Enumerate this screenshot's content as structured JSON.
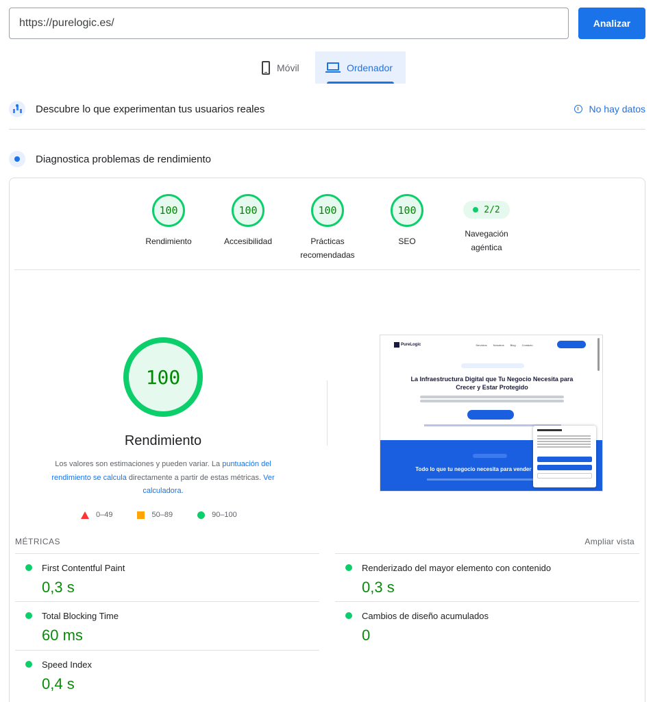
{
  "search": {
    "url": "https://purelogic.es/",
    "analyze_label": "Analizar"
  },
  "device_tabs": [
    {
      "label": "Móvil",
      "icon": "phone-icon",
      "selected": false
    },
    {
      "label": "Ordenador",
      "icon": "laptop-icon",
      "selected": true
    }
  ],
  "field_section": {
    "title": "Descubre lo que experimentan tus usuarios reales",
    "status": "No hay datos"
  },
  "lab_section": {
    "title": "Diagnostica problemas de rendimiento"
  },
  "categories": [
    {
      "score": "100",
      "label": "Rendimiento"
    },
    {
      "score": "100",
      "label": "Accesibilidad"
    },
    {
      "score": "100",
      "label": "Prácticas recomendadas"
    },
    {
      "score": "100",
      "label": "SEO"
    },
    {
      "score": "2/2",
      "label": "Navegación agéntica"
    }
  ],
  "performance": {
    "score": "100",
    "label": "Rendimiento",
    "desc_before": "Los valores son estimaciones y pueden variar. La ",
    "desc_link1": "puntuación del rendimiento se calcula",
    "desc_middle": " directamente a partir de estas métricas. ",
    "desc_link2": "Ver calculadora.",
    "legend": [
      "0–49",
      "50–89",
      "90–100"
    ]
  },
  "thumbnail": {
    "logo": "PureLogic",
    "nav_links": [
      "Servicios",
      "Nosotros",
      "Blog",
      "Contacto"
    ],
    "headline": "La Infraestructura Digital que Tu Negocio Necesita para Crecer y Estar Protegido",
    "blue_headline": "Todo lo que tu negocio necesita para vender más"
  },
  "metrics_section": {
    "title": "MÉTRICAS",
    "expand_label": "Ampliar vista"
  },
  "metrics": [
    {
      "label": "First Contentful Paint",
      "value": "0,3 s"
    },
    {
      "label": "Renderizado del mayor elemento con contenido",
      "value": "0,3 s"
    },
    {
      "label": "Total Blocking Time",
      "value": "60 ms"
    },
    {
      "label": "Cambios de diseño acumulados",
      "value": "0"
    },
    {
      "label": "Speed Index",
      "value": "0,4 s"
    }
  ],
  "colors": {
    "accent": "#1a73e8",
    "pass": "#0cce6b",
    "average": "#ffa400",
    "fail": "#ff3333"
  }
}
